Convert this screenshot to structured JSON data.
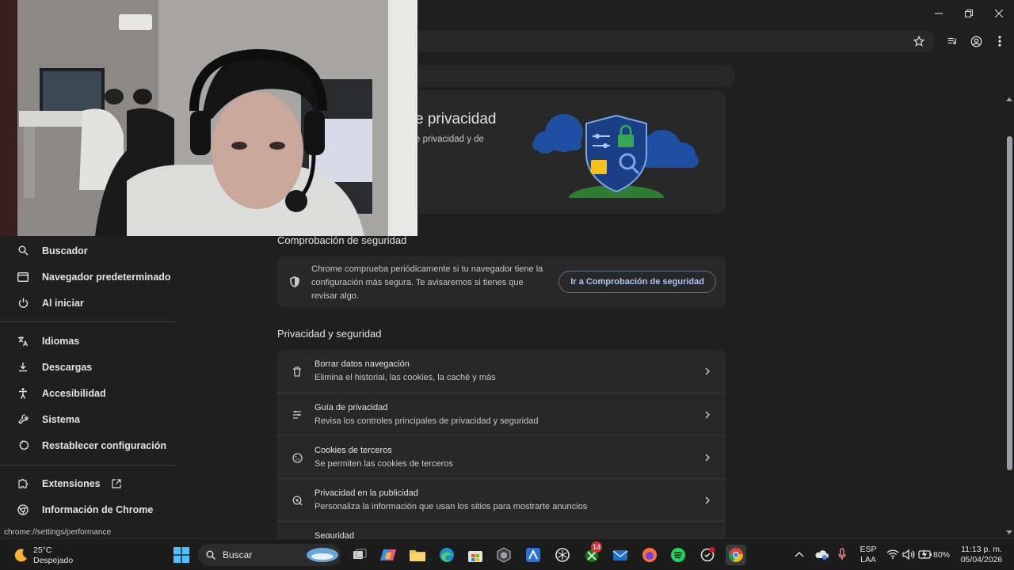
{
  "window": {
    "minimize_icon": "minimize-icon",
    "restore_icon": "restore-icon",
    "close_icon": "close-icon"
  },
  "toolbar": {
    "bookmark_icon": "star-icon",
    "reading_list_icon": "media-queue-icon",
    "profile_icon": "profile-icon",
    "menu_icon": "kebab-menu-icon"
  },
  "hero": {
    "title": "e privacidad",
    "subtitle": "e privacidad y de"
  },
  "sidebar": {
    "items": [
      {
        "label": "Buscador",
        "icon": "search-icon"
      },
      {
        "label": "Navegador predeterminado",
        "icon": "browser-window-icon"
      },
      {
        "label": "Al iniciar",
        "icon": "power-icon"
      },
      {
        "label": "Idiomas",
        "icon": "translate-icon"
      },
      {
        "label": "Descargas",
        "icon": "download-icon"
      },
      {
        "label": "Accesibilidad",
        "icon": "accessibility-icon"
      },
      {
        "label": "Sistema",
        "icon": "wrench-icon"
      },
      {
        "label": "Restablecer configuración",
        "icon": "reset-icon"
      },
      {
        "label": "Extensiones",
        "icon": "puzzle-icon"
      },
      {
        "label": "Información de Chrome",
        "icon": "chrome-icon"
      }
    ]
  },
  "safety_check": {
    "section_title": "Comprobación de seguridad",
    "text": "Chrome comprueba periódicamente si tu navegador tiene la configuración más segura. Te avisaremos si tienes que revisar algo.",
    "button": "Ir a Comprobación de seguridad"
  },
  "privacy": {
    "section_title": "Privacidad y seguridad",
    "rows": [
      {
        "title": "Borrar datos navegación",
        "subtitle": "Elimina el historial, las cookies, la caché y más",
        "icon": "trash-icon"
      },
      {
        "title": "Guía de privacidad",
        "subtitle": "Revisa los controles principales de privacidad y seguridad",
        "icon": "privacy-guide-icon"
      },
      {
        "title": "Cookies de terceros",
        "subtitle": "Se permiten las cookies de terceros",
        "icon": "cookie-icon"
      },
      {
        "title": "Privacidad en la publicidad",
        "subtitle": "Personaliza la información que usan los sitios para mostrarte anuncios",
        "icon": "ad-privacy-icon"
      },
      {
        "title": "Seguridad",
        "subtitle": "",
        "icon": "shield-icon"
      }
    ]
  },
  "status_bar": {
    "url": "chrome://settings/performance"
  },
  "taskbar": {
    "weather_temp": "25°C",
    "weather_desc": "Despejado",
    "search_label": "Buscar",
    "xbox_badge": "14",
    "lang_top": "ESP",
    "lang_bottom": "LAA",
    "battery": "80%",
    "time": "11:13 p. m.",
    "date": "05/04/2026"
  },
  "colors": {
    "background": "#1f1f1f",
    "card": "#282828",
    "accent_text": "#a8c7fa",
    "chrome_blue": "#1a73e8"
  }
}
